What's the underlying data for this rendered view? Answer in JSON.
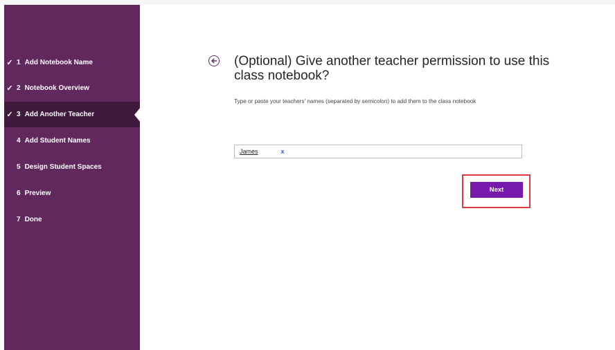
{
  "sidebar": {
    "steps": [
      {
        "number": "1",
        "label": "Add Notebook Name",
        "completed": true,
        "active": false
      },
      {
        "number": "2",
        "label": "Notebook Overview",
        "completed": true,
        "active": false
      },
      {
        "number": "3",
        "label": "Add Another Teacher",
        "completed": true,
        "active": true
      },
      {
        "number": "4",
        "label": "Add Student Names",
        "completed": false,
        "active": false
      },
      {
        "number": "5",
        "label": "Design Student Spaces",
        "completed": false,
        "active": false
      },
      {
        "number": "6",
        "label": "Preview",
        "completed": false,
        "active": false
      },
      {
        "number": "7",
        "label": "Done",
        "completed": false,
        "active": false
      }
    ],
    "check_glyph": "✓",
    "background_color": "#61285e",
    "active_color": "#3f1a3d"
  },
  "main": {
    "back_icon": "arrow-left-circle-icon",
    "title": "(Optional) Give another teacher permission to use this class notebook?",
    "instructions": "Type or paste your teachers' names (separated by semicolon) to add them to the class notebook",
    "teacher_input": {
      "token_name": "James",
      "remove_label": "x"
    },
    "next_button": {
      "label": "Next",
      "color": "#7719aa"
    },
    "highlight_color": "#e0393e"
  }
}
